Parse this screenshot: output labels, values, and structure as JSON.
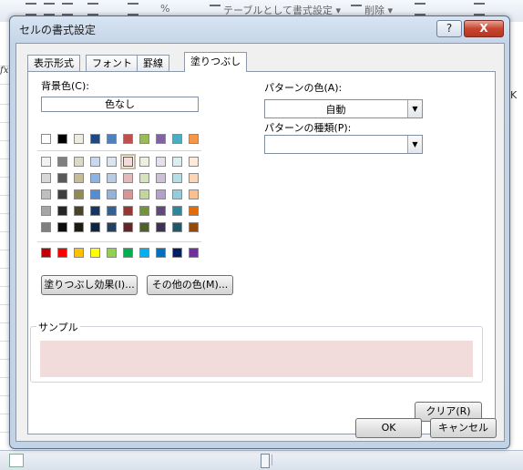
{
  "background": {
    "ribbon": {
      "format_as_table": "テーブルとして書式設定",
      "delete": "削除",
      "percent": "%"
    },
    "fx_label": "fx",
    "column_letter": "K"
  },
  "dialog": {
    "title": "セルの書式設定",
    "help_label": "?",
    "close_label": "X",
    "tabs": [
      {
        "label": "表示形式",
        "active": false
      },
      {
        "label": "フォント",
        "active": false
      },
      {
        "label": "罫線",
        "active": false
      },
      {
        "label": "塗りつぶし",
        "active": true
      }
    ],
    "background_color": {
      "label": "背景色(C):",
      "no_color_label": "色なし",
      "theme_top_row": [
        "#ffffff",
        "#000000",
        "#eeece1",
        "#1f497d",
        "#4f81bd",
        "#c0504d",
        "#9bbb59",
        "#8064a2",
        "#4bacc6",
        "#f79646"
      ],
      "theme_tints": [
        [
          "#f2f2f2",
          "#7f7f7f",
          "#ddd9c3",
          "#c6d9f0",
          "#dbe5f1",
          "#f2dcdb",
          "#ebf1dd",
          "#e5e0ec",
          "#dbeef3",
          "#fdeada"
        ],
        [
          "#d8d8d8",
          "#595959",
          "#c4bd97",
          "#8db3e2",
          "#b8cce4",
          "#e5b9b7",
          "#d7e3bc",
          "#ccc1d9",
          "#b7dde8",
          "#fbd5b5"
        ],
        [
          "#bfbfbf",
          "#3f3f3f",
          "#938953",
          "#548dd4",
          "#95b3d7",
          "#d99694",
          "#c3d69b",
          "#b2a2c7",
          "#92cddc",
          "#fac08f"
        ],
        [
          "#a5a5a5",
          "#262626",
          "#494429",
          "#17365d",
          "#366092",
          "#953734",
          "#76923c",
          "#5f497a",
          "#31859b",
          "#e36c09"
        ],
        [
          "#7f7f7f",
          "#0c0c0c",
          "#1d1b10",
          "#0f243e",
          "#244061",
          "#632423",
          "#4f6128",
          "#3f3151",
          "#205867",
          "#974806"
        ]
      ],
      "standard_colors": [
        "#c00000",
        "#ff0000",
        "#ffc000",
        "#ffff00",
        "#92d050",
        "#00b050",
        "#00b0f0",
        "#0070c0",
        "#002060",
        "#7030a0"
      ],
      "selected_color": "#f2dcdb"
    },
    "fill_effects_button": "塗りつぶし効果(I)...",
    "more_colors_button": "その他の色(M)...",
    "pattern_color": {
      "label": "パターンの色(A):",
      "value": "自動"
    },
    "pattern_style": {
      "label": "パターンの種類(P):",
      "value": ""
    },
    "sample": {
      "label": "サンプル",
      "color": "#f2dcdb"
    },
    "clear_button": "クリア(R)",
    "ok_button": "OK",
    "cancel_button": "キャンセル"
  }
}
